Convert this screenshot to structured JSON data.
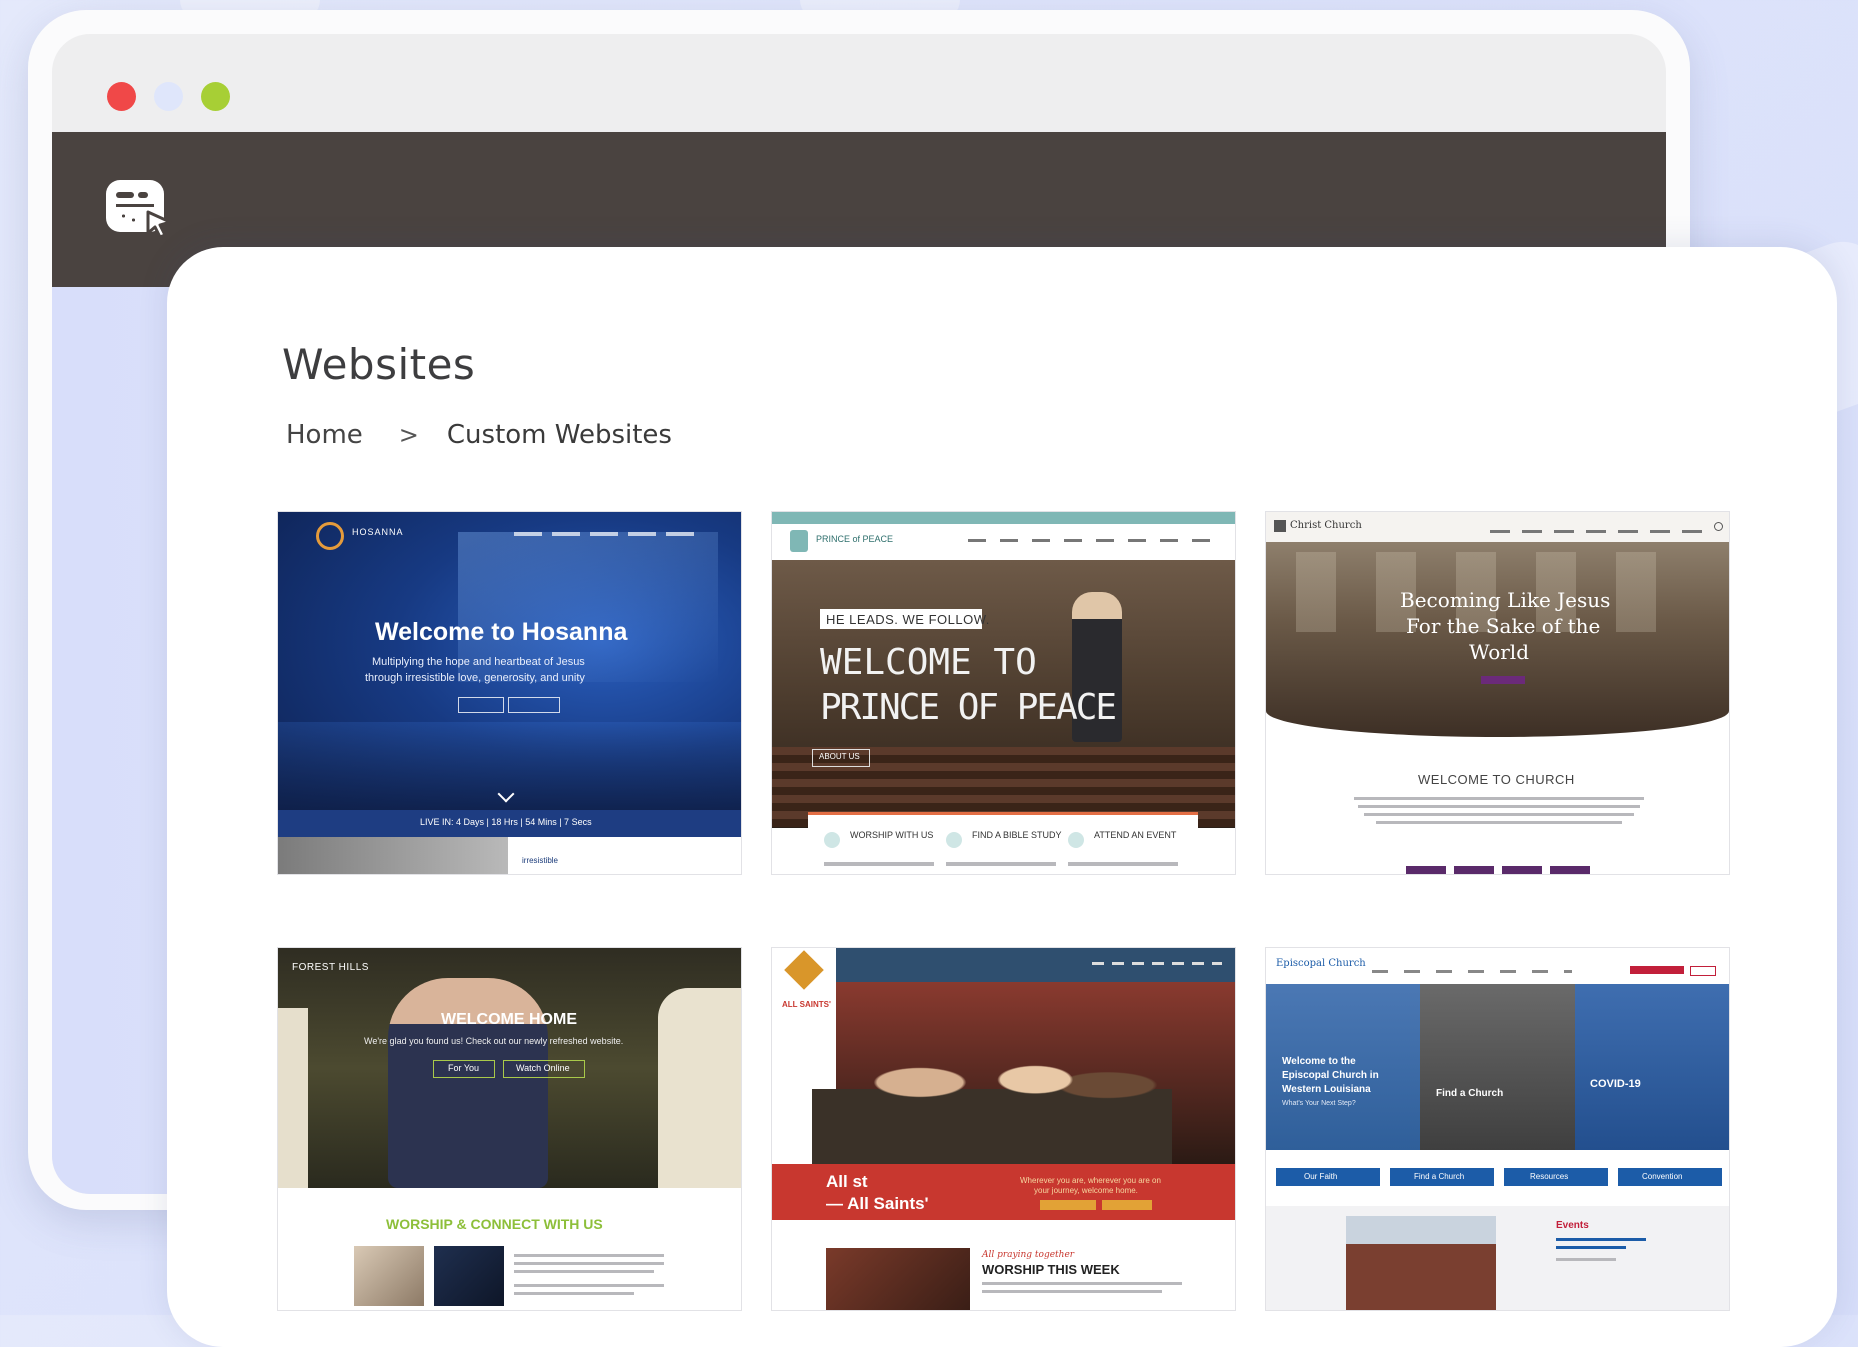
{
  "window": {
    "dots": [
      "#f04848",
      "#dfe6fb",
      "#a7cf35"
    ],
    "appbar_color": "#4a4340"
  },
  "app_icon": "gallery-cursor-icon",
  "page": {
    "title": "Websites",
    "breadcrumb": {
      "home": "Home",
      "separator": ">",
      "current": "Custom Websites"
    }
  },
  "thumbnails": [
    {
      "site": "hosanna",
      "logo": "HOSANNA",
      "headline": "Welcome to Hosanna",
      "subline1": "Multiplying the hope and heartbeat of Jesus",
      "subline2": "through irresistible love, generosity, and unity",
      "footer_text": "LIVE IN: 4 Days | 18 Hrs | 54 Mins | 7 Secs",
      "bottom_label": "irresistible",
      "accent": "#1b3b7a"
    },
    {
      "site": "prince-of-peace",
      "logo": "PRINCE of PEACE",
      "tagline": "HE LEADS. WE FOLLOW.",
      "headline1": "WELCOME TO",
      "headline2": "PRINCE OF PEACE",
      "button": "ABOUT US",
      "items": [
        "WORSHIP WITH US",
        "FIND A BIBLE STUDY",
        "ATTEND AN EVENT"
      ],
      "accent": "#7fb7b5"
    },
    {
      "site": "christ-church",
      "logo": "Christ Church",
      "headline1": "Becoming Like Jesus",
      "headline2": "For the Sake of the",
      "headline3": "World",
      "section": "WELCOME TO CHURCH",
      "accent": "#5a2a6a"
    },
    {
      "site": "forest-hills",
      "logo": "FOREST HILLS",
      "headline": "WELCOME HOME",
      "subline": "We're glad you found us! Check out our newly refreshed website.",
      "button1": "For You",
      "button2": "Watch Online",
      "section": "WORSHIP & CONNECT WITH US",
      "accent": "#8dbf3a"
    },
    {
      "site": "all-saints",
      "logo": "ALL SAINTS'",
      "band1": "All st",
      "band2": "— All Saints'",
      "band_tag1": "Wherever you are, wherever you are on",
      "band_tag2": "your journey, welcome home.",
      "section_small": "All praying together",
      "section": "WORSHIP THIS WEEK",
      "accent": "#c8372f"
    },
    {
      "site": "episcopal",
      "logo": "Episcopal Church",
      "panel1_1": "Welcome to the",
      "panel1_2": "Episcopal Church in",
      "panel1_3": "Western Louisiana",
      "panel1_4": "What's Your Next Step?",
      "panel2_1": "Find a Church",
      "panel3_1": "COVID-19",
      "buttons": [
        "Our Faith",
        "Find a Church",
        "Resources",
        "Convention"
      ],
      "events": "Events",
      "accent": "#1c5ca8"
    }
  ]
}
